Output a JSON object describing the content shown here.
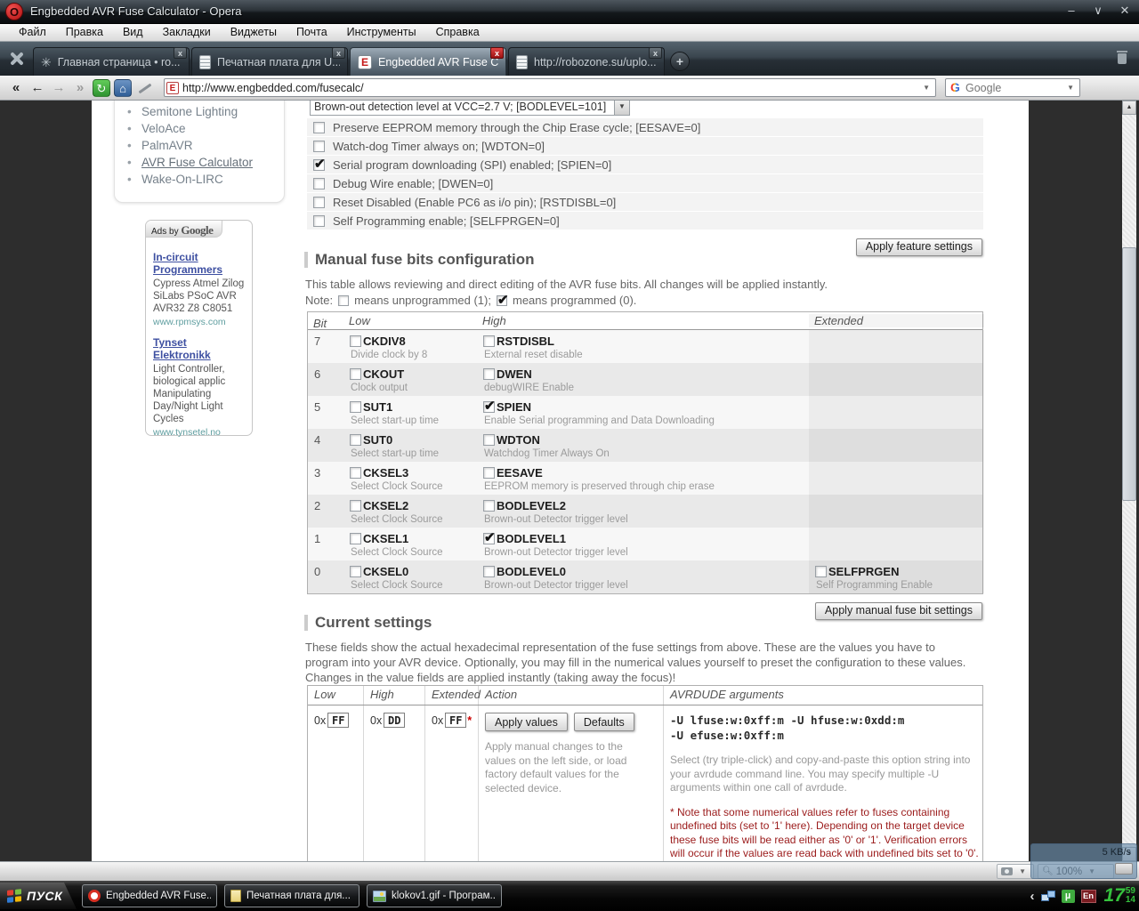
{
  "window": {
    "title": "Engbedded AVR Fuse Calculator - Opera",
    "opera_logo_letter": "O",
    "menu": [
      "Файл",
      "Правка",
      "Вид",
      "Закладки",
      "Виджеты",
      "Почта",
      "Инструменты",
      "Справка"
    ],
    "tabs": [
      {
        "label": "Главная страница • ro...",
        "icon": "speeddial-icon",
        "active": false
      },
      {
        "label": "Печатная плата для U...",
        "icon": "document-icon",
        "active": false
      },
      {
        "label": "Engbedded AVR Fuse C...",
        "icon": "opera-icon",
        "active": true
      },
      {
        "label": "http://robozone.su/uplo...",
        "icon": "document-icon",
        "active": false
      }
    ],
    "new_tab_label": "+",
    "address": "http://www.engbedded.com/fusecalc/",
    "search_placeholder": "Google"
  },
  "sidebar": {
    "items": [
      {
        "label": "Semitone Lighting",
        "current": false
      },
      {
        "label": "VeloAce",
        "current": false
      },
      {
        "label": "PalmAVR",
        "current": false
      },
      {
        "label": "AVR Fuse Calculator",
        "current": true
      },
      {
        "label": "Wake-On-LIRC",
        "current": false
      }
    ]
  },
  "ads": {
    "header_prefix": "Ads by",
    "header_brand": "Google",
    "items": [
      {
        "title": "In-circuit Programmers",
        "body": "Cypress Atmel Zilog SiLabs PSoC AVR AVR32 Z8 C8051",
        "url": "www.rpmsys.com"
      },
      {
        "title": "Tynset Elektronikk",
        "body": "Light Controller, biological applic Manipulating Day/Night Light Cycles",
        "url": "www.tynsetel.no"
      }
    ]
  },
  "features": {
    "dropdown_value": "Brown-out detection level at VCC=2.7 V; [BODLEVEL=101]",
    "options": [
      {
        "label": "Preserve EEPROM memory through the Chip Erase cycle; [EESAVE=0]",
        "checked": false
      },
      {
        "label": "Watch-dog Timer always on; [WDTON=0]",
        "checked": false
      },
      {
        "label": "Serial program downloading (SPI) enabled; [SPIEN=0]",
        "checked": true
      },
      {
        "label": "Debug Wire enable; [DWEN=0]",
        "checked": false
      },
      {
        "label": "Reset Disabled (Enable PC6 as i/o pin); [RSTDISBL=0]",
        "checked": false
      },
      {
        "label": "Self Programming enable; [SELFPRGEN=0]",
        "checked": false
      }
    ],
    "apply_button": "Apply feature settings"
  },
  "manual": {
    "title": "Manual fuse bits configuration",
    "description": "This table allows reviewing and direct editing of the AVR fuse bits. All changes will be applied instantly.",
    "note_prefix": "Note:",
    "note_unprogrammed": "means unprogrammed (1);",
    "note_programmed": "means programmed (0).",
    "columns": [
      "Bit",
      "Low",
      "High",
      "Extended"
    ],
    "rows": [
      {
        "bit": "7",
        "low": {
          "name": "CKDIV8",
          "desc": "Divide clock by 8",
          "checked": false
        },
        "high": {
          "name": "RSTDISBL",
          "desc": "External reset disable",
          "checked": false
        },
        "ext": null
      },
      {
        "bit": "6",
        "low": {
          "name": "CKOUT",
          "desc": "Clock output",
          "checked": false
        },
        "high": {
          "name": "DWEN",
          "desc": "debugWIRE Enable",
          "checked": false
        },
        "ext": null
      },
      {
        "bit": "5",
        "low": {
          "name": "SUT1",
          "desc": "Select start-up time",
          "checked": false
        },
        "high": {
          "name": "SPIEN",
          "desc": "Enable Serial programming and Data Downloading",
          "checked": true
        },
        "ext": null
      },
      {
        "bit": "4",
        "low": {
          "name": "SUT0",
          "desc": "Select start-up time",
          "checked": false
        },
        "high": {
          "name": "WDTON",
          "desc": "Watchdog Timer Always On",
          "checked": false
        },
        "ext": null
      },
      {
        "bit": "3",
        "low": {
          "name": "CKSEL3",
          "desc": "Select Clock Source",
          "checked": false
        },
        "high": {
          "name": "EESAVE",
          "desc": "EEPROM memory is preserved through chip erase",
          "checked": false
        },
        "ext": null
      },
      {
        "bit": "2",
        "low": {
          "name": "CKSEL2",
          "desc": "Select Clock Source",
          "checked": false
        },
        "high": {
          "name": "BODLEVEL2",
          "desc": "Brown-out Detector trigger level",
          "checked": false
        },
        "ext": null
      },
      {
        "bit": "1",
        "low": {
          "name": "CKSEL1",
          "desc": "Select Clock Source",
          "checked": false
        },
        "high": {
          "name": "BODLEVEL1",
          "desc": "Brown-out Detector trigger level",
          "checked": true
        },
        "ext": null
      },
      {
        "bit": "0",
        "low": {
          "name": "CKSEL0",
          "desc": "Select Clock Source",
          "checked": false
        },
        "high": {
          "name": "BODLEVEL0",
          "desc": "Brown-out Detector trigger level",
          "checked": false
        },
        "ext": {
          "name": "SELFPRGEN",
          "desc": "Self Programming Enable",
          "checked": false
        }
      }
    ],
    "apply_button": "Apply manual fuse bit settings"
  },
  "current": {
    "title": "Current settings",
    "description": "These fields show the actual hexadecimal representation of the fuse settings from above. These are the values you have to program into your AVR device. Optionally, you may fill in the numerical values yourself to preset the configuration to these values. Changes in the value fields are applied instantly (taking away the focus)!",
    "columns": [
      "Low",
      "High",
      "Extended",
      "Action",
      "AVRDUDE arguments"
    ],
    "hex_prefix": "0x",
    "low_value": "FF",
    "high_value": "DD",
    "ext_value": "FF",
    "ext_star": "*",
    "apply_values_button": "Apply values",
    "defaults_button": "Defaults",
    "action_desc": "Apply manual changes to the values on the left side, or load factory default values for the selected device.",
    "avrdude_args": "-U lfuse:w:0xff:m -U hfuse:w:0xdd:m\n-U efuse:w:0xff:m",
    "avrdude_help": "Select (try triple-click) and copy-and-paste this option string into your avrdude command line. You may specify multiple -U arguments within one call of avrdude.",
    "avrdude_note": "* Note that some numerical values refer to fuses containing undefined bits (set to '1' here). Depending on the target device these fuse bits will be read either as '0' or '1'. Verification errors will occur if the values are read back with undefined bits set to '0'. Everything is fine if the values read from the device are either the same as programmed, or the"
  },
  "statusbar": {
    "zoom": "100%",
    "speed": "5 KB/s"
  },
  "taskbar": {
    "start": "ПУСК",
    "buttons": [
      {
        "label": "Engbedded AVR Fuse...",
        "icon": "opera-icon"
      },
      {
        "label": "Печатная плата для...",
        "icon": "notepad-icon"
      },
      {
        "label": "klokov1.gif - Програм...",
        "icon": "image-icon"
      }
    ],
    "lang": "En",
    "clock_hour": "17",
    "clock_min": "59",
    "clock_sec": "14"
  }
}
